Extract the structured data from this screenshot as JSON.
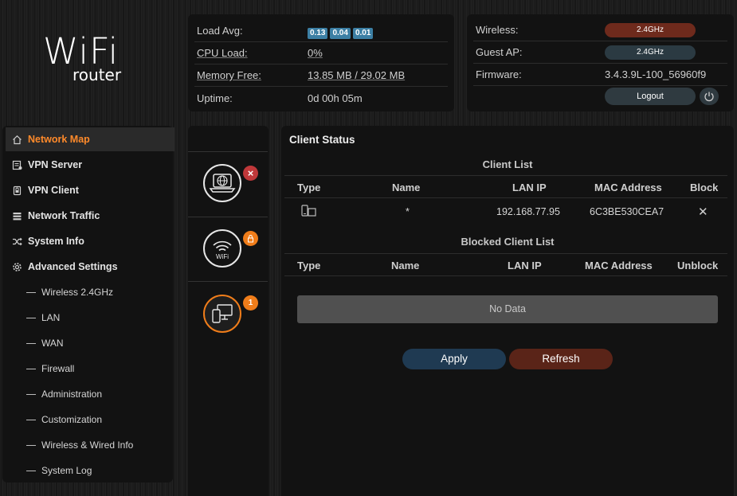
{
  "logo": {
    "main": "WiFi",
    "sub": "router"
  },
  "system": {
    "load_avg_label": "Load Avg:",
    "load_avg": [
      "0.13",
      "0.04",
      "0.01"
    ],
    "cpu_label": "CPU Load:",
    "cpu_value": "0%",
    "memory_label": "Memory Free:",
    "memory_value": "13.85 MB / 29.02 MB",
    "uptime_label": "Uptime:",
    "uptime_value": "0d 00h 05m"
  },
  "router": {
    "wireless_label": "Wireless:",
    "wireless_value": "2.4GHz",
    "guest_label": "Guest AP:",
    "guest_value": "2.4GHz",
    "firmware_label": "Firmware:",
    "firmware_value": "3.4.3.9L-100_56960f9",
    "logout_label": "Logout"
  },
  "sidebar": {
    "items": [
      {
        "label": "Network Map",
        "icon": "home-icon"
      },
      {
        "label": "VPN Server",
        "icon": "vpn-server-icon"
      },
      {
        "label": "VPN Client",
        "icon": "vpn-client-icon"
      },
      {
        "label": "Network Traffic",
        "icon": "traffic-icon"
      },
      {
        "label": "System Info",
        "icon": "shuffle-icon"
      },
      {
        "label": "Advanced Settings",
        "icon": "gear-icon"
      }
    ],
    "sub_items": [
      "Wireless 2.4GHz",
      "LAN",
      "WAN",
      "Firewall",
      "Administration",
      "Customization",
      "Wireless & Wired Info",
      "System Log"
    ]
  },
  "status_icons": {
    "internet_badge": "×",
    "wifi_text": "WiFi",
    "wifi_badge": "lock",
    "clients_badge": "1"
  },
  "client_status": {
    "title": "Client Status",
    "client_list_title": "Client List",
    "columns": [
      "Type",
      "Name",
      "LAN IP",
      "MAC Address",
      "Block"
    ],
    "clients": [
      {
        "name": "*",
        "ip": "192.168.77.95",
        "mac": "6C3BE530CEA7",
        "block": "✕"
      }
    ],
    "blocked_title": "Blocked Client List",
    "blocked_columns": [
      "Type",
      "Name",
      "LAN IP",
      "MAC Address",
      "Unblock"
    ],
    "no_data": "No Data",
    "apply_label": "Apply",
    "refresh_label": "Refresh"
  },
  "colors": {
    "accent": "#ff8a2a",
    "badge_blue": "#3c7fa4",
    "wireless_pill": "#6e2a1c",
    "guest_pill": "#2b3a42",
    "apply": "#1f3a52",
    "refresh": "#5a2418"
  }
}
